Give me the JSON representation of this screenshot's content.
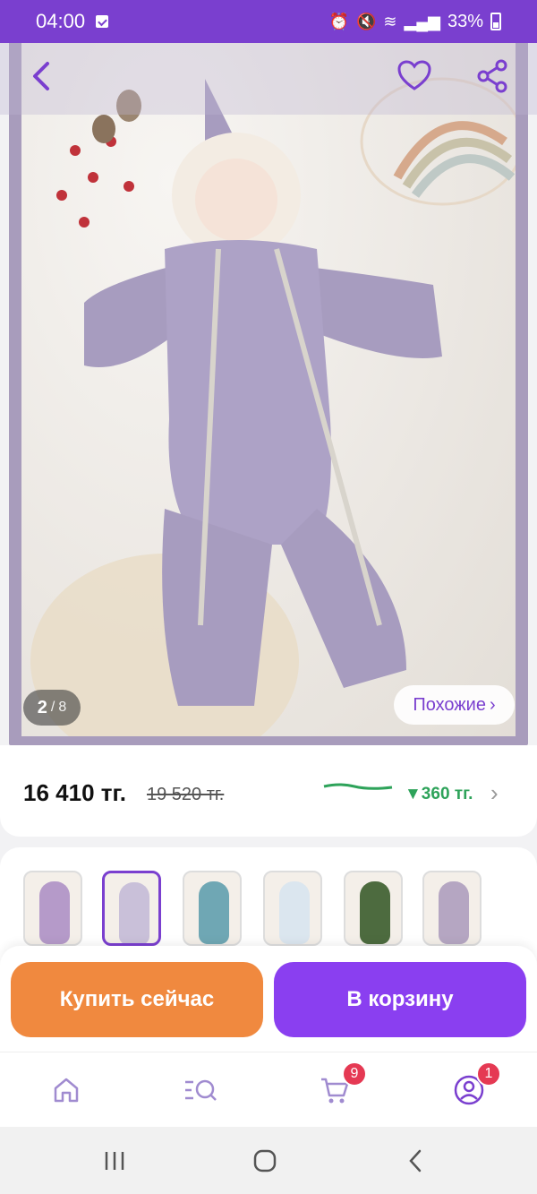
{
  "status_bar": {
    "time": "04:00",
    "battery_percent": "33%"
  },
  "product": {
    "gallery": {
      "current": "2",
      "separator": "/",
      "total": "8"
    },
    "similar_label": "Похожие",
    "price": "16 410 тг.",
    "old_price": "19 520 тг.",
    "price_drop": "▼360 тг."
  },
  "variants": [
    {
      "name": "floral-purple",
      "color": "#b59ac9"
    },
    {
      "name": "lavender",
      "color": "#c9c0d9"
    },
    {
      "name": "teal",
      "color": "#6fa7b4"
    },
    {
      "name": "white-blue-print",
      "color": "#dbe6ef"
    },
    {
      "name": "green-print",
      "color": "#4d6b3f"
    },
    {
      "name": "lilac",
      "color": "#b5a6c2"
    }
  ],
  "actions": {
    "buy_now_label": "Купить сейчас",
    "add_to_cart_label": "В корзину"
  },
  "bottom_nav": {
    "cart_badge": "9",
    "profile_badge": "1"
  },
  "colors": {
    "accent": "#7a3fcf",
    "buy_button": "#f0893f",
    "cart_button": "#8a3ff0",
    "badge": "#e53953",
    "price_drop": "#2ea35a"
  }
}
